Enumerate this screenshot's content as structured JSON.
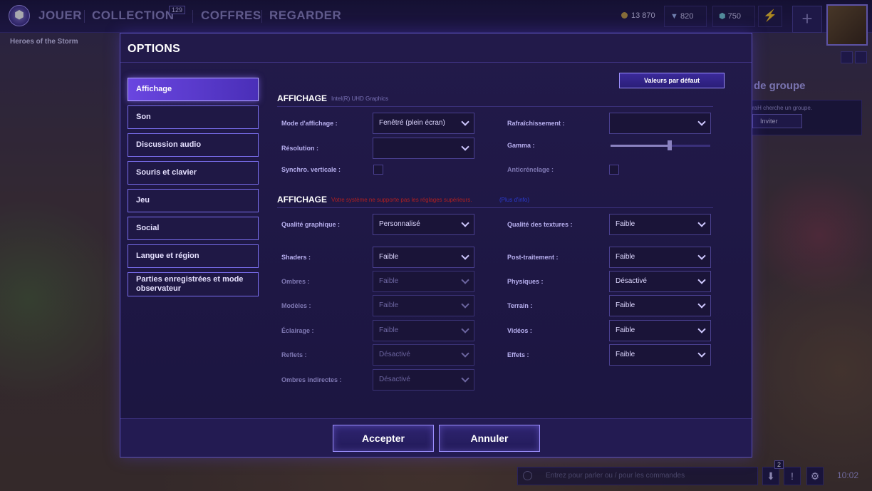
{
  "topbar": {
    "logo_glyph": "⬢",
    "nav": [
      "JOUER",
      "COLLECTION",
      "COFFRES",
      "REGARDER"
    ],
    "collection_badge": "129",
    "game_label": "Heroes of the Storm",
    "gold": "13 870",
    "gems": "820",
    "shards": "750",
    "boost_glyph": "⚡",
    "plus_glyph": "+"
  },
  "group": {
    "title": "de groupe",
    "text": "raH cherche un groupe.",
    "invite_label": "Inviter"
  },
  "options": {
    "title": "OPTIONS",
    "default_button": "Valeurs par défaut",
    "sidebar": [
      "Affichage",
      "Son",
      "Discussion audio",
      "Souris et clavier",
      "Jeu",
      "Social",
      "Langue et région",
      "Parties enregistrées et mode observateur"
    ],
    "section1": {
      "title": "AFFICHAGE",
      "subtitle": "Intel(R) UHD Graphics",
      "mode_label": "Mode d'affichage :",
      "mode_value": "Fenêtré (plein écran)",
      "refresh_label": "Rafraîchissement :",
      "refresh_value": "",
      "resolution_label": "Résolution :",
      "resolution_value": "",
      "gamma_label": "Gamma :",
      "gamma_level": 0.59,
      "vsync_label": "Synchro. verticale :",
      "aa_label": "Anticrénelage :"
    },
    "section2": {
      "title": "AFFICHAGE",
      "warning": "Votre système ne supporte pas les réglages supérieurs.",
      "link": "(Plus d'info)",
      "left": [
        {
          "label": "Qualité graphique :",
          "value": "Personnalisé",
          "dim": false
        },
        {
          "label": "Shaders :",
          "value": "Faible",
          "dim": false
        },
        {
          "label": "Ombres :",
          "value": "Faible",
          "dim": true
        },
        {
          "label": "Modèles :",
          "value": "Faible",
          "dim": true
        },
        {
          "label": "Éclairage :",
          "value": "Faible",
          "dim": true
        },
        {
          "label": "Reflets :",
          "value": "Désactivé",
          "dim": true
        },
        {
          "label": "Ombres indirectes :",
          "value": "Désactivé",
          "dim": true
        }
      ],
      "right": [
        {
          "label": "Qualité des textures :",
          "value": "Faible"
        },
        {
          "label": "Post-traitement :",
          "value": "Faible"
        },
        {
          "label": "Physiques :",
          "value": "Désactivé"
        },
        {
          "label": "Terrain :",
          "value": "Faible"
        },
        {
          "label": "Vidéos :",
          "value": "Faible"
        },
        {
          "label": "Effets :",
          "value": "Faible"
        }
      ]
    },
    "accept": "Accepter",
    "cancel": "Annuler"
  },
  "chat": {
    "placeholder": "Entrez pour parler ou / pour les commandes",
    "notif_count": "2",
    "clock": "10:02",
    "download_glyph": "⬇",
    "alert_glyph": "!",
    "settings_glyph": "⚙"
  }
}
